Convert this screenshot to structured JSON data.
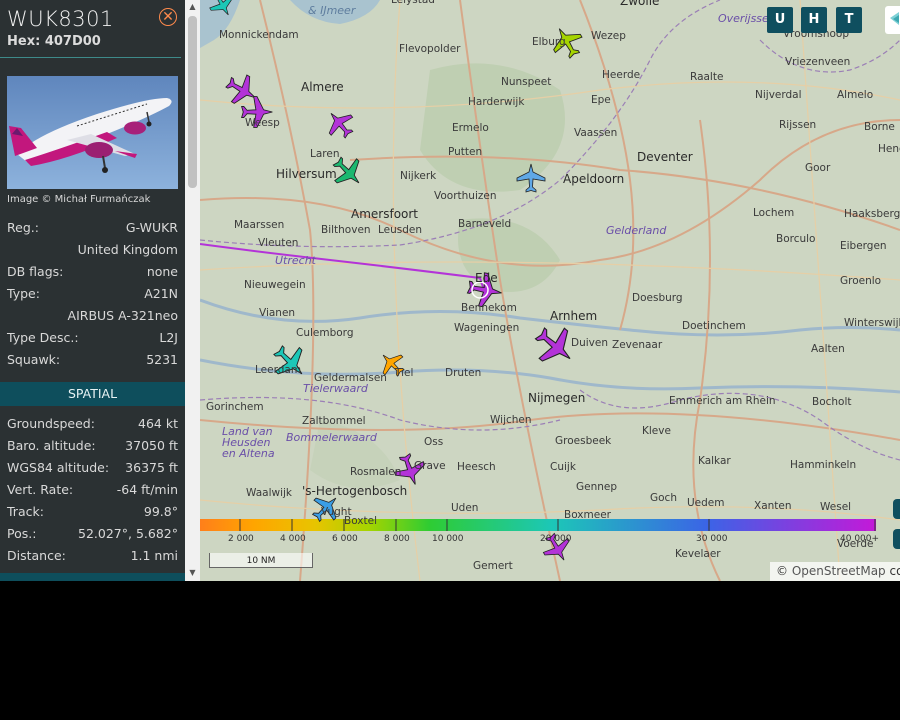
{
  "aircraft": {
    "callsign": "WUK8301",
    "hex_label": "Hex:",
    "hex": "407D00",
    "photo_credit": "Image © Michał Furmańczak"
  },
  "details": [
    {
      "label": "Reg.:",
      "value": "G-WUKR"
    },
    {
      "label": "",
      "value": "United Kingdom"
    },
    {
      "label": "DB flags:",
      "value": "none"
    },
    {
      "label": "Type:",
      "value": "A21N"
    },
    {
      "label": "",
      "value": "AIRBUS A-321neo"
    },
    {
      "label": "Type Desc.:",
      "value": "L2J"
    },
    {
      "label": "Squawk:",
      "value": "5231"
    }
  ],
  "spatial_header": "SPATIAL",
  "spatial": [
    {
      "label": "Groundspeed:",
      "value": "464 kt"
    },
    {
      "label": "Baro. altitude:",
      "value": "37050 ft"
    },
    {
      "label": "WGS84 altitude:",
      "value": "36375 ft"
    },
    {
      "label": "Vert. Rate:",
      "value": "-64 ft/min"
    },
    {
      "label": "Track:",
      "value": "99.8°"
    },
    {
      "label": "Pos.:",
      "value": "52.027°, 5.682°"
    },
    {
      "label": "Distance:",
      "value": "1.1 nmi"
    }
  ],
  "map": {
    "buttons": [
      "U",
      "H",
      "T"
    ],
    "scale_label": "10 NM",
    "attribution_symbol": "©",
    "attribution": "OpenStreetMap",
    "attribution_suffix": "cor",
    "altitude_legend": [
      "2 000",
      "4 000",
      "6 000",
      "8 000",
      "10 000",
      "20 000",
      "30 000",
      "40 000+"
    ],
    "places": [
      {
        "name": "Lelystad",
        "type": "town"
      },
      {
        "name": "Zwolle",
        "type": "big"
      },
      {
        "name": "Overijssel",
        "type": "region"
      },
      {
        "name": "& IJmeer",
        "type": "water"
      },
      {
        "name": "Monnickendam",
        "type": "town"
      },
      {
        "name": "Flevopolder",
        "type": "town"
      },
      {
        "name": "Elburg",
        "type": "town"
      },
      {
        "name": "Wezep",
        "type": "town"
      },
      {
        "name": "Vroomshoop",
        "type": "town"
      },
      {
        "name": "Vriezenveen",
        "type": "town"
      },
      {
        "name": "Almere",
        "type": "big"
      },
      {
        "name": "Nunspeet",
        "type": "town"
      },
      {
        "name": "Heerde",
        "type": "town"
      },
      {
        "name": "Raalte",
        "type": "town"
      },
      {
        "name": "Nijverdal",
        "type": "town"
      },
      {
        "name": "Almelo",
        "type": "town"
      },
      {
        "name": "Harderwijk",
        "type": "town"
      },
      {
        "name": "Epe",
        "type": "town"
      },
      {
        "name": "Weesp",
        "type": "town"
      },
      {
        "name": "Ermelo",
        "type": "town"
      },
      {
        "name": "Vaassen",
        "type": "town"
      },
      {
        "name": "Rijssen",
        "type": "town"
      },
      {
        "name": "Borne",
        "type": "town"
      },
      {
        "name": "Laren",
        "type": "town"
      },
      {
        "name": "Putten",
        "type": "town"
      },
      {
        "name": "Deventer",
        "type": "big"
      },
      {
        "name": "Hengelo",
        "type": "town"
      },
      {
        "name": "Hilversum",
        "type": "big"
      },
      {
        "name": "Nijkerk",
        "type": "town"
      },
      {
        "name": "Apeldoorn",
        "type": "big"
      },
      {
        "name": "Goor",
        "type": "town"
      },
      {
        "name": "Voorthuizen",
        "type": "town"
      },
      {
        "name": "Amersfoort",
        "type": "big"
      },
      {
        "name": "Lochem",
        "type": "town"
      },
      {
        "name": "Haaksbergen",
        "type": "town"
      },
      {
        "name": "Maarssen",
        "type": "town"
      },
      {
        "name": "Bilthoven",
        "type": "town"
      },
      {
        "name": "Leusden",
        "type": "town"
      },
      {
        "name": "Barneveld",
        "type": "town"
      },
      {
        "name": "Gelderland",
        "type": "region"
      },
      {
        "name": "Borculo",
        "type": "town"
      },
      {
        "name": "Vleuten",
        "type": "town"
      },
      {
        "name": "Eibergen",
        "type": "town"
      },
      {
        "name": "Utrecht",
        "type": "region"
      },
      {
        "name": "Nieuwegein",
        "type": "town"
      },
      {
        "name": "Ede",
        "type": "big"
      },
      {
        "name": "Groenlo",
        "type": "town"
      },
      {
        "name": "Bennekom",
        "type": "town"
      },
      {
        "name": "Doesburg",
        "type": "town"
      },
      {
        "name": "Vianen",
        "type": "town"
      },
      {
        "name": "Arnhem",
        "type": "big"
      },
      {
        "name": "Winterswijk",
        "type": "town"
      },
      {
        "name": "Wageningen",
        "type": "town"
      },
      {
        "name": "Doetinchem",
        "type": "town"
      },
      {
        "name": "Culemborg",
        "type": "town"
      },
      {
        "name": "Duiven",
        "type": "town"
      },
      {
        "name": "Zevenaar",
        "type": "town"
      },
      {
        "name": "Aalten",
        "type": "town"
      },
      {
        "name": "Leerdam",
        "type": "town"
      },
      {
        "name": "Geldermalsen",
        "type": "town"
      },
      {
        "name": "Tiel",
        "type": "town"
      },
      {
        "name": "Druten",
        "type": "town"
      },
      {
        "name": "Tielerwaard",
        "type": "region"
      },
      {
        "name": "Nijmegen",
        "type": "big"
      },
      {
        "name": "Gorinchem",
        "type": "town"
      },
      {
        "name": "Emmerich am Rhein",
        "type": "town"
      },
      {
        "name": "Bocholt",
        "type": "town"
      },
      {
        "name": "Zaltbommel",
        "type": "town"
      },
      {
        "name": "Wijchen",
        "type": "town"
      },
      {
        "name": "Kleve",
        "type": "town"
      },
      {
        "name": "Land van Heusden en Altena",
        "type": "region"
      },
      {
        "name": "Bommelerwaard",
        "type": "region"
      },
      {
        "name": "Oss",
        "type": "town"
      },
      {
        "name": "Groesbeek",
        "type": "town"
      },
      {
        "name": "Grave",
        "type": "town"
      },
      {
        "name": "Heesch",
        "type": "town"
      },
      {
        "name": "Cuijk",
        "type": "town"
      },
      {
        "name": "Kalkar",
        "type": "town"
      },
      {
        "name": "Hamminkeln",
        "type": "town"
      },
      {
        "name": "Rosmalen",
        "type": "town"
      },
      {
        "name": "Gennep",
        "type": "town"
      },
      {
        "name": "Waalwijk",
        "type": "town"
      },
      {
        "name": "'s-Hertogenbosch",
        "type": "big"
      },
      {
        "name": "Goch",
        "type": "town"
      },
      {
        "name": "Uedem",
        "type": "town"
      },
      {
        "name": "Xanten",
        "type": "town"
      },
      {
        "name": "Wesel",
        "type": "town"
      },
      {
        "name": "Vught",
        "type": "town"
      },
      {
        "name": "Uden",
        "type": "town"
      },
      {
        "name": "Boxtel",
        "type": "town"
      },
      {
        "name": "Boxmeer",
        "type": "town"
      },
      {
        "name": "Kevelaer",
        "type": "town"
      },
      {
        "name": "Gemert",
        "type": "town"
      },
      {
        "name": "Voerde",
        "type": "town"
      }
    ]
  }
}
